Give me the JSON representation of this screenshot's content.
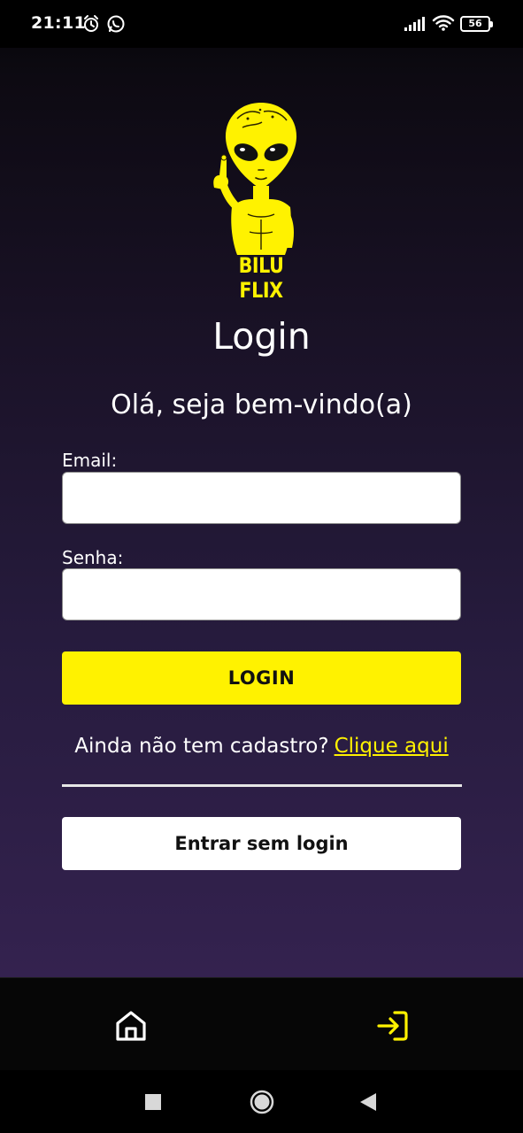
{
  "status_bar": {
    "time": "21:11",
    "battery": "56",
    "icons": [
      "alarm-icon",
      "whatsapp-icon",
      "signal-icon",
      "wifi-icon",
      "battery-icon"
    ]
  },
  "logo": {
    "text": "BILU FLIX",
    "color": "#fff200"
  },
  "page": {
    "title": "Login",
    "subtitle": "Olá, seja bem-vindo(a)"
  },
  "form": {
    "email": {
      "label": "Email:",
      "value": "",
      "placeholder": ""
    },
    "password": {
      "label": "Senha:",
      "value": "",
      "placeholder": ""
    },
    "login_button": "LOGIN"
  },
  "register": {
    "prompt": "Ainda não tem cadastro?",
    "link": "Clique aqui"
  },
  "guest_button": "Entrar sem login",
  "tab_bar": {
    "items": [
      {
        "icon": "home-icon",
        "active": false
      },
      {
        "icon": "login-icon",
        "active": true
      }
    ]
  },
  "nav_bar": {
    "buttons": [
      "recents-button",
      "home-button",
      "back-button"
    ]
  },
  "colors": {
    "accent": "#fff200",
    "background_top": "#050507",
    "background_bottom": "#34224f"
  }
}
